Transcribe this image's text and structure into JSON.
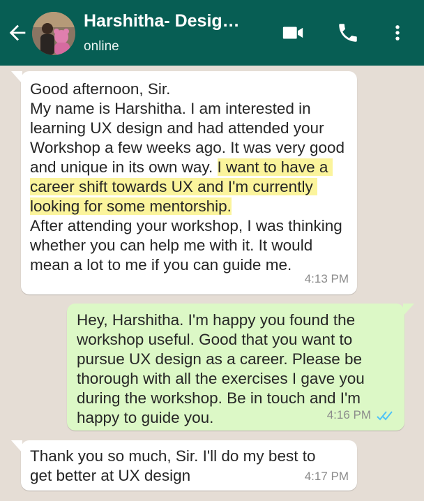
{
  "header": {
    "title": "Harshitha- Desig…",
    "status": "online",
    "bg_color": "#075e54",
    "icons": [
      "back-arrow-icon",
      "video-call-icon",
      "phone-icon",
      "more-options-icon"
    ]
  },
  "messages": [
    {
      "direction": "incoming",
      "text_before": "Good afternoon, Sir.\nMy name is Harshitha. I am interested in learning UX design and had attended your Workshop a few weeks ago. It was very good and unique in its own way. ",
      "highlight": "I want to have a career shift towards UX and I'm currently looking for some mentorship.",
      "text_after": "\nAfter attending your workshop, I was thinking whether you can help me with it. It would mean a lot to me if you can guide me.",
      "time": "4:13 PM"
    },
    {
      "direction": "outgoing",
      "text": "Hey, Harshitha. I'm happy you found the workshop useful. Good that you want to pursue UX design as a career. Please be thorough with all the exercises I gave you during the workshop. Be in touch and I'm happy to guide you.",
      "time": "4:16 PM",
      "read_receipt": "double-check-icon"
    },
    {
      "direction": "incoming",
      "text": "Thank you so much, Sir. I'll do my best to get better at UX design",
      "time": "4:17 PM"
    }
  ],
  "colors": {
    "chat_bg": "#e5ddd5",
    "incoming_bubble": "#ffffff",
    "outgoing_bubble": "#dcf8c6",
    "highlight": "#fbf49c",
    "read_tick": "#4fc3f7"
  }
}
